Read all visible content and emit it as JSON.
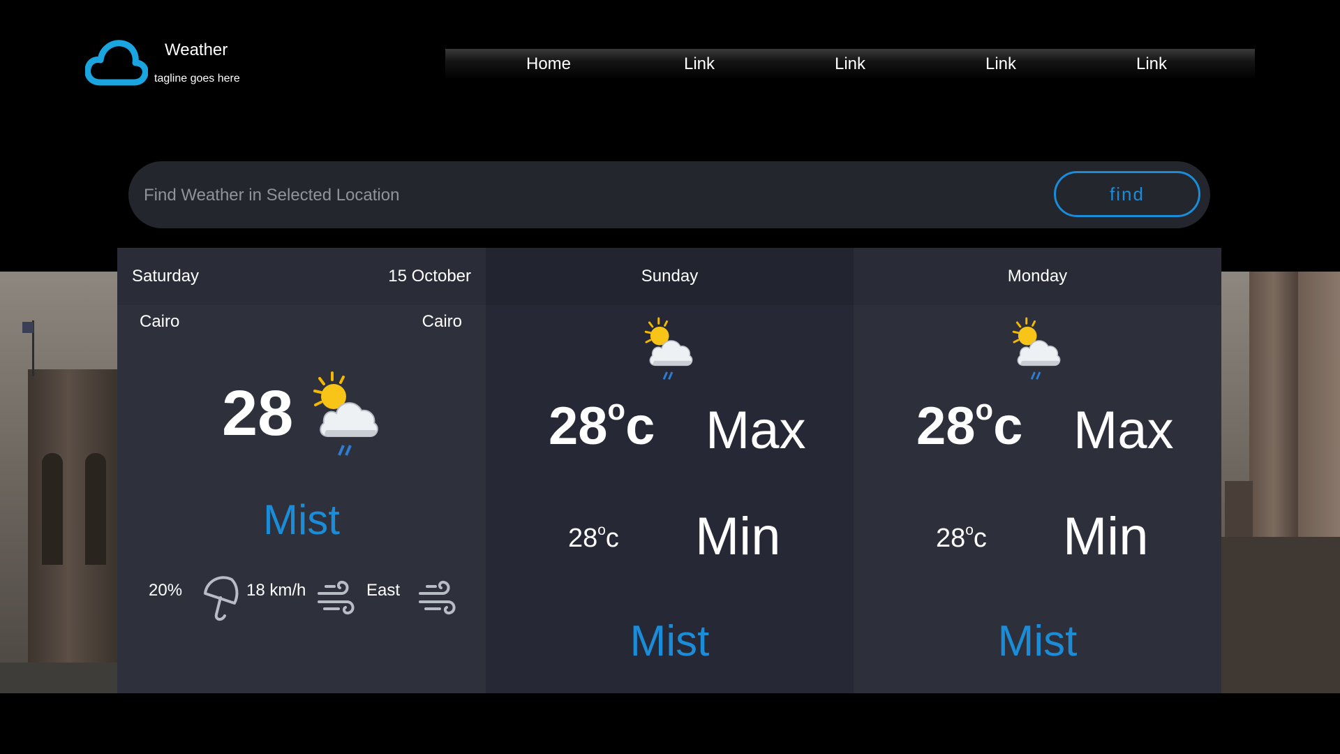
{
  "brand": {
    "name": "Weather",
    "tagline": "tagline goes here",
    "logo_icon": "cloud-icon",
    "accent_color": "#1a8cd8"
  },
  "nav": {
    "items": [
      {
        "label": "Home"
      },
      {
        "label": "Link"
      },
      {
        "label": "Link"
      },
      {
        "label": "Link"
      },
      {
        "label": "Link"
      }
    ]
  },
  "search": {
    "placeholder": "Find Weather in Selected Location",
    "button_label": "find"
  },
  "today": {
    "day": "Saturday",
    "date": "15 October",
    "city_left": "Cairo",
    "city_right": "Cairo",
    "temp": "28",
    "icon": "partly-cloudy-rain-icon",
    "description": "Mist",
    "humidity": "20%",
    "humidity_icon": "umbrella-icon",
    "wind_speed": "18 km/h",
    "wind_icon": "wind-icon",
    "wind_direction": "East",
    "direction_icon": "wind-icon"
  },
  "forecast": [
    {
      "day": "Sunday",
      "icon": "partly-cloudy-rain-icon",
      "max_temp": "28",
      "max_unit": "o",
      "max_suffix": "c",
      "max_label": "Max",
      "min_temp": "28",
      "min_unit": "o",
      "min_suffix": "c",
      "min_label": "Min",
      "description": "Mist"
    },
    {
      "day": "Monday",
      "icon": "partly-cloudy-rain-icon",
      "max_temp": "28",
      "max_unit": "o",
      "max_suffix": "c",
      "max_label": "Max",
      "min_temp": "28",
      "min_unit": "o",
      "min_suffix": "c",
      "min_label": "Min",
      "description": "Mist"
    }
  ]
}
